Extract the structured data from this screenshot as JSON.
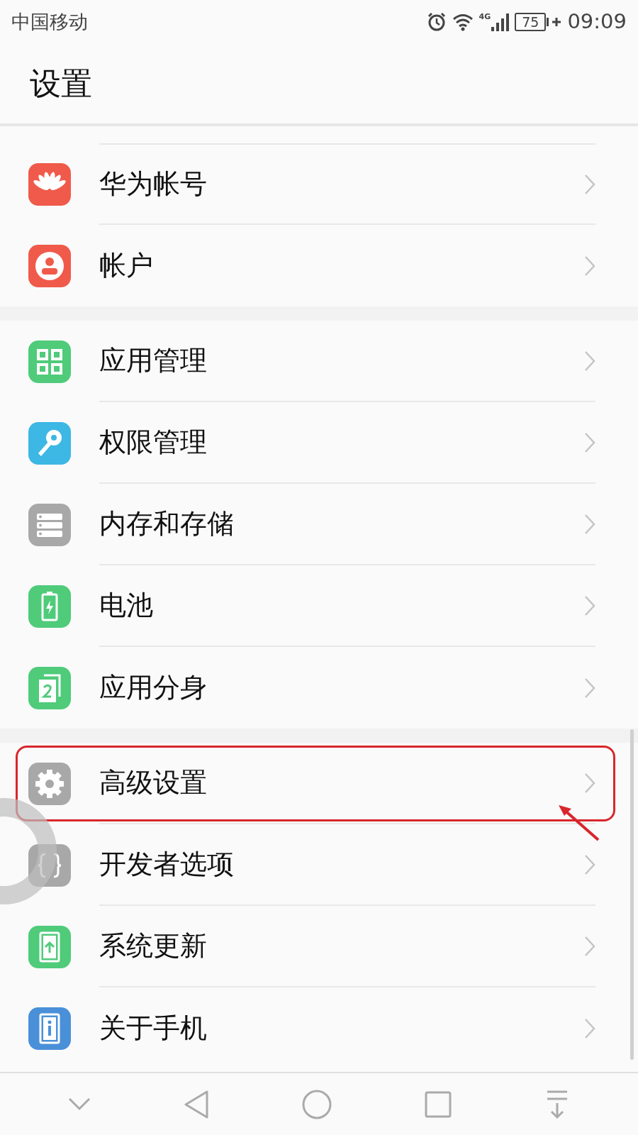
{
  "status_bar": {
    "carrier": "中国移动",
    "network": "4G",
    "battery": "75",
    "time": "09:09"
  },
  "title": "设置",
  "sections": [
    {
      "items": [
        {
          "label": "华为帐号",
          "kind": "petals",
          "color": "#f05a4a",
          "highlighted": false
        },
        {
          "label": "帐户",
          "kind": "person",
          "color": "#f05a4a",
          "highlighted": false
        }
      ]
    },
    {
      "items": [
        {
          "label": "应用管理",
          "kind": "grid",
          "color": "#4fcb7a",
          "highlighted": false
        },
        {
          "label": "权限管理",
          "kind": "key",
          "color": "#3db7e4",
          "highlighted": false
        },
        {
          "label": "内存和存储",
          "kind": "storage",
          "color": "#a8a8a8",
          "highlighted": false
        },
        {
          "label": "电池",
          "kind": "battery",
          "color": "#4fcb7a",
          "highlighted": false
        },
        {
          "label": "应用分身",
          "kind": "twin",
          "color": "#4fcb7a",
          "highlighted": false
        }
      ]
    },
    {
      "items": [
        {
          "label": "高级设置",
          "kind": "gear",
          "color": "#a8a8a8",
          "highlighted": true
        },
        {
          "label": "开发者选项",
          "kind": "braces",
          "color": "#a8a8a8",
          "highlighted": false
        },
        {
          "label": "系统更新",
          "kind": "update",
          "color": "#4fcb7a",
          "highlighted": false
        },
        {
          "label": "关于手机",
          "kind": "info",
          "color": "#4a90d9",
          "highlighted": false
        }
      ]
    }
  ]
}
